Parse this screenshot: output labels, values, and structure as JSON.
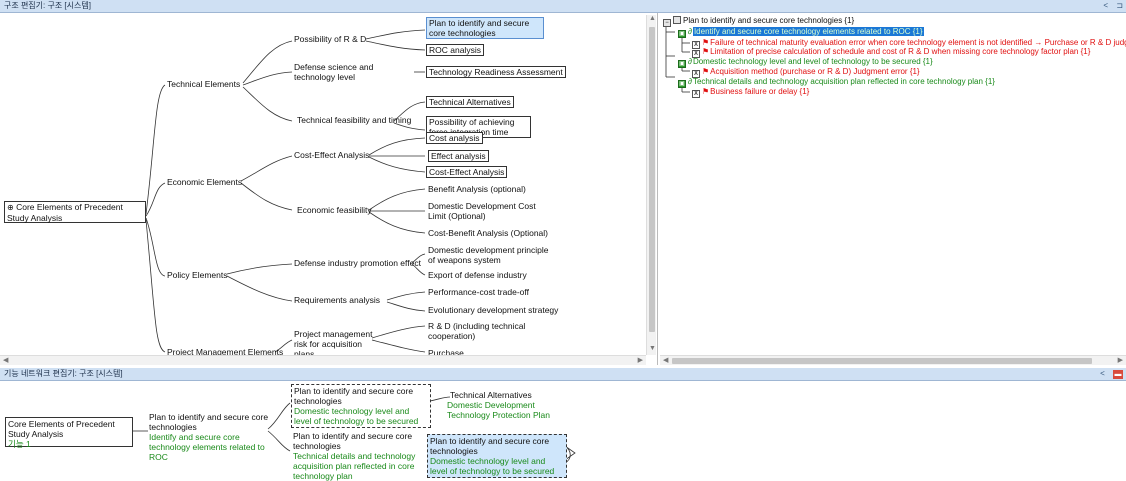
{
  "top_header": {
    "title": "구조 편집기: 구조 [시스템]",
    "buttons": [
      "<",
      "⊐"
    ]
  },
  "bottom_header": {
    "title": "기능 네트워크 편집기: 구조 [시스템]",
    "buttons": [
      "<"
    ]
  },
  "tree": {
    "root": "Core Elements of Precedent Study Analysis",
    "categories": [
      "Technical  Elements",
      "Economic Elements",
      "Policy Elements",
      "Project Management Elements"
    ],
    "sub": {
      "possibility_rd": "Possibility of R & D",
      "defense_science": "Defense science and technology level",
      "tech_feasibility": "Technical feasibility and timing",
      "cost_effect": "Cost-Effect Analysis",
      "econ_feasibility": "Economic feasibility",
      "defense_industry": "Defense industry promotion effect",
      "requirements": "Requirements analysis",
      "pm_risk": "Project management risk for acquisition plans"
    },
    "leaves": {
      "plan_core": "Plan to identify and secure core technologies",
      "roc": "ROC analysis",
      "tra": "Technology Readiness Assessment",
      "tech_alt": "Technical Alternatives",
      "force_integration": "Possibility of achieving force integration time",
      "cost_analysis": "Cost analysis",
      "effect_analysis": "Effect analysis",
      "cost_effect_analysis": "Cost-Effect Analysis",
      "benefit": "Benefit Analysis (optional)",
      "dom_cost_limit": "Domestic Development Cost Limit (Optional)",
      "cost_benefit": "Cost-Benefit Analysis (Optional)",
      "dom_principle": "Domestic development principle of weapons system",
      "export": "Export of defense industry",
      "perf_cost": "Performance-cost trade-off",
      "evolutionary": "Evolutionary development strategy",
      "rd_coop": "R & D (including technical cooperation)",
      "purchase": "Purchase"
    }
  },
  "right_tree": [
    {
      "text": "Plan to identify and secure core technologies {1}",
      "color": "black"
    },
    {
      "text": "Identify and secure core technology elements related to ROC {1}",
      "color": "highlight"
    },
    {
      "text": "Failure of technical maturity evaluation error when core technology element is not identified → Purchase or R & D judg",
      "color": "red"
    },
    {
      "text": "Limitation of precise calculation of schedule and cost of R & D when missing core technology factor plan {1}",
      "color": "red"
    },
    {
      "text": "Domestic technology level and level of technology to be secured {1}",
      "color": "green"
    },
    {
      "text": "Acquisition method (purchase or R & D) Judgment error {1}",
      "color": "red"
    },
    {
      "text": "Technical details and technology acquisition plan reflected in core technology plan {1}",
      "color": "green"
    },
    {
      "text": "Business failure or delay {1}",
      "color": "red"
    }
  ],
  "network": {
    "root": "Core Elements of Precedent Study Analysis",
    "root_sub": "기능 1",
    "func1": "Plan to identify and secure core technologies",
    "func1_sub": "Identify and secure core technology elements related to ROC",
    "dashed1": "Plan to identify and secure core technologies",
    "dashed1_sub": "Domestic technology level and level of technology to be secured",
    "tech_alt": "Technical Alternatives",
    "tech_alt_sub": "Domestic Development Technology Protection Plan",
    "func2": "Plan to identify and secure core technologies",
    "func2_sub": "Technical details and technology acquisition plan reflected in core technology plan",
    "selected": "Plan to identify and secure core technologies",
    "selected_sub": "Domestic technology level and level of technology to be secured"
  },
  "colors": {
    "header": "#cfe0f3",
    "selection": "#cfe6fb",
    "green": "#1a8a1a",
    "red": "#e01010",
    "tree_highlight": "#1b78d6"
  }
}
